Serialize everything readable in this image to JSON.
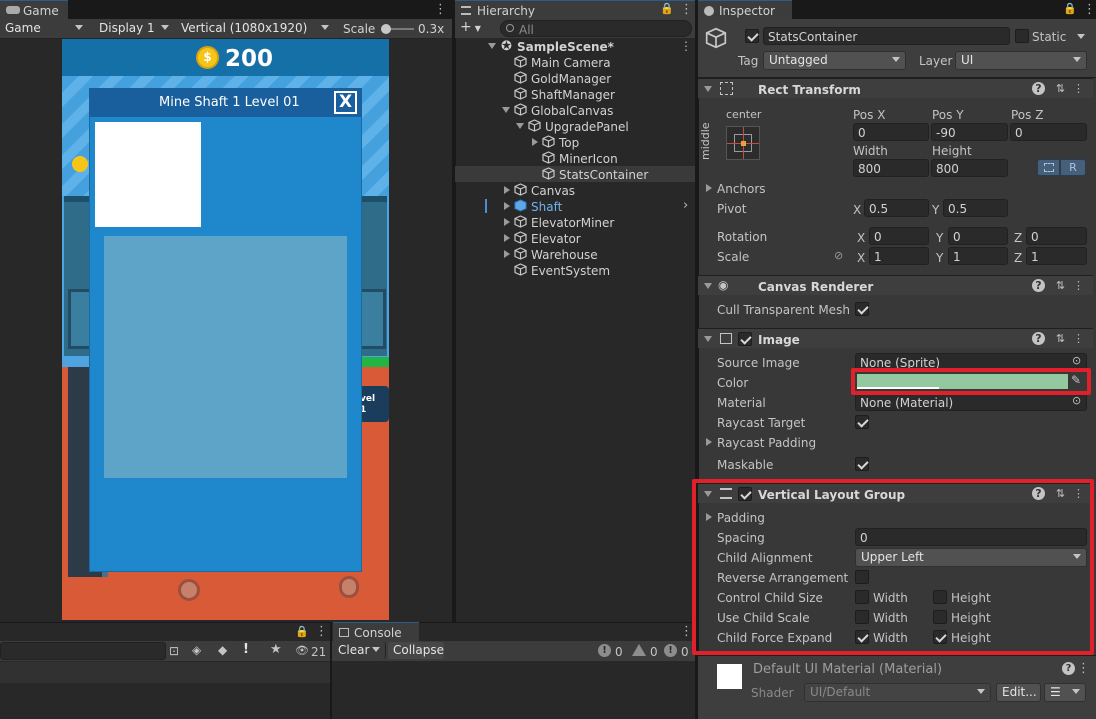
{
  "game": {
    "tab": "Game",
    "mode": "Game",
    "display": "Display 1",
    "resolution": "Vertical (1080x1920)",
    "scale_label": "Scale",
    "scale_value": "0.3x",
    "coin_count": "200",
    "panel_title": "Mine Shaft 1 Level 01",
    "close_label": "X",
    "side_label_1": "vel",
    "side_label_2": "1"
  },
  "hierarchy": {
    "tab": "Hierarchy",
    "search_placeholder": "All",
    "scene": "SampleScene*",
    "items": [
      {
        "name": "Main Camera"
      },
      {
        "name": "GoldManager"
      },
      {
        "name": "ShaftManager"
      },
      {
        "name": "GlobalCanvas"
      },
      {
        "name": "UpgradePanel"
      },
      {
        "name": "Top"
      },
      {
        "name": "MinerIcon"
      },
      {
        "name": "StatsContainer"
      },
      {
        "name": "Canvas"
      },
      {
        "name": "Shaft"
      },
      {
        "name": "ElevatorMiner"
      },
      {
        "name": "Elevator"
      },
      {
        "name": "Warehouse"
      },
      {
        "name": "EventSystem"
      }
    ]
  },
  "bottom": {
    "console_tab": "Console",
    "clear": "Clear",
    "collapse": "Collapse",
    "log_count": "0",
    "warn_count": "0",
    "error_count": "0",
    "hidden_count": "21"
  },
  "inspector": {
    "tab": "Inspector",
    "object_name": "StatsContainer",
    "static_label": "Static",
    "tag_label": "Tag",
    "tag_value": "Untagged",
    "layer_label": "Layer",
    "layer_value": "UI",
    "rect": {
      "title": "Rect Transform",
      "anchor_h": "center",
      "anchor_v": "middle",
      "posx_label": "Pos X",
      "posx": "0",
      "posy_label": "Pos Y",
      "posy": "-90",
      "posz_label": "Pos Z",
      "posz": "0",
      "width_label": "Width",
      "width": "800",
      "height_label": "Height",
      "height": "800",
      "r_label": "R",
      "anchors": "Anchors",
      "pivot": "Pivot",
      "pivot_x": "0.5",
      "pivot_y": "0.5",
      "rotation": "Rotation",
      "rot_x": "0",
      "rot_y": "0",
      "rot_z": "0",
      "scale": "Scale",
      "scale_x": "1",
      "scale_y": "1",
      "scale_z": "1"
    },
    "canvas_renderer": {
      "title": "Canvas Renderer",
      "cull": "Cull Transparent Mesh"
    },
    "image": {
      "title": "Image",
      "source_label": "Source Image",
      "source_value": "None (Sprite)",
      "color_label": "Color",
      "color_value": "#94c89e",
      "material_label": "Material",
      "material_value": "None (Material)",
      "raycast_target": "Raycast Target",
      "raycast_padding": "Raycast Padding",
      "maskable": "Maskable"
    },
    "vlg": {
      "title": "Vertical Layout Group",
      "padding": "Padding",
      "spacing_label": "Spacing",
      "spacing_value": "0",
      "alignment_label": "Child Alignment",
      "alignment_value": "Upper Left",
      "reverse": "Reverse Arrangement",
      "control_size": "Control Child Size",
      "use_scale": "Use Child Scale",
      "force_expand": "Child Force Expand",
      "width": "Width",
      "height": "Height"
    },
    "material": {
      "name": "Default UI Material (Material)",
      "shader_label": "Shader",
      "shader_value": "UI/Default",
      "edit": "Edit..."
    }
  },
  "colors": {
    "highlight": "#e0202a",
    "selected_row": "#3a3a3a",
    "panel_blue": "#1f88cc",
    "panel_header": "#1a5f9d"
  }
}
